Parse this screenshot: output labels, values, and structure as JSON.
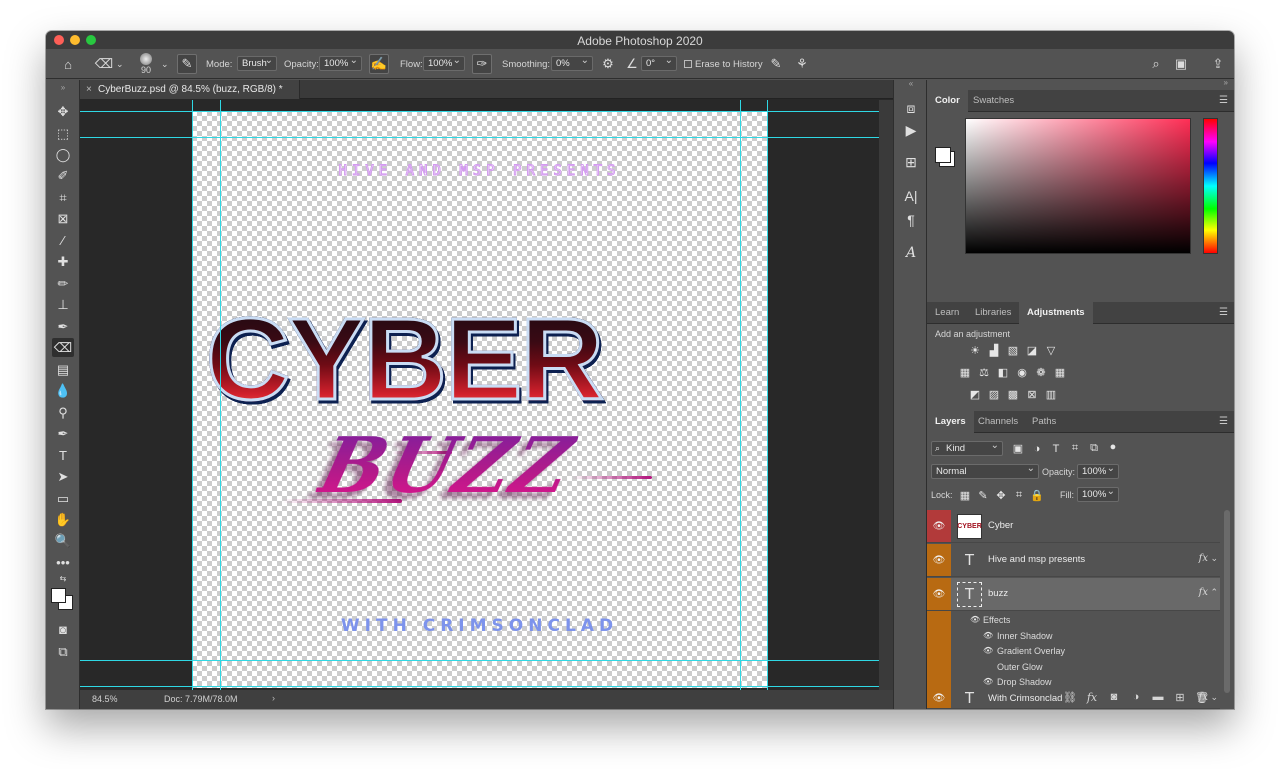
{
  "app": {
    "title": "Adobe Photoshop 2020"
  },
  "options": {
    "brush_size": "90",
    "mode_label": "Mode:",
    "mode_value": "Brush",
    "opacity_label": "Opacity:",
    "opacity_value": "100%",
    "flow_label": "Flow:",
    "flow_value": "100%",
    "smoothing_label": "Smoothing:",
    "smoothing_value": "0%",
    "angle_value": "0°",
    "erase_history_label": "Erase to History"
  },
  "document": {
    "tab_title": "CyberBuzz.psd @ 84.5% (buzz, RGB/8) *",
    "zoom": "84.5%",
    "doc_size": "Doc: 7.79M/78.0M"
  },
  "artwork": {
    "presents_text": "HIVE AND MSP PRESENTS",
    "cyber_text": "CYBER",
    "buzz_text": "BUZZ",
    "with_text": "WITH CRIMSONCLAD"
  },
  "panels": {
    "color_tabs": [
      "Color",
      "Swatches"
    ],
    "adjust_tabs": [
      "Learn",
      "Libraries",
      "Adjustments"
    ],
    "add_adjustment": "Add an adjustment",
    "layers_tabs": [
      "Layers",
      "Channels",
      "Paths"
    ],
    "kind_filter": "Kind",
    "blend_mode": "Normal",
    "opacity_label": "Opacity:",
    "opacity_value": "100%",
    "lock_label": "Lock:",
    "fill_label": "Fill:",
    "fill_value": "100%"
  },
  "layers": [
    {
      "name": "Cyber",
      "type": "smart",
      "label_color": "#b23a3a"
    },
    {
      "name": "Hive and msp presents",
      "type": "text",
      "fx": "fx",
      "label_color": "#b86a12"
    },
    {
      "name": "buzz",
      "type": "text",
      "fx": "fx",
      "selected": true,
      "label_color": "#b86a12"
    },
    {
      "name": "With Crimsonclad",
      "type": "text",
      "fx": "fx",
      "label_color": "#b86a12"
    }
  ],
  "effects": {
    "header": "Effects",
    "items": [
      "Inner Shadow",
      "Gradient Overlay",
      "Outer Glow",
      "Drop Shadow"
    ]
  },
  "colors": {
    "guide": "#2fd8e4",
    "foreground": "#ffffff",
    "background": "#ffffff"
  }
}
